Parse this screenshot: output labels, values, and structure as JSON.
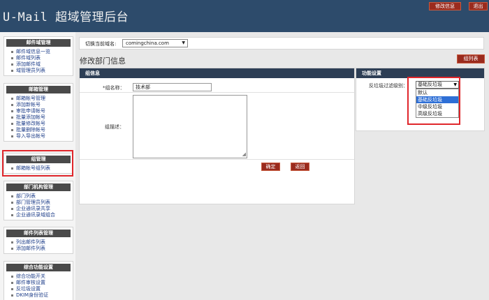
{
  "header": {
    "title": "U-Mail 超域管理后台",
    "change_password": "修改信息",
    "logout": "退出"
  },
  "sidebar": {
    "sections": [
      {
        "title": "邮件域管理",
        "items": [
          "邮件域信息一览",
          "邮件域列表",
          "添加邮件域",
          "域管理员列表"
        ]
      },
      {
        "title": "邮箱管理",
        "items": [
          "邮箱帐号管理",
          "添加新帐号",
          "审批申请帐号",
          "批量添加帐号",
          "批量修改帐号",
          "批量删除帐号",
          "导入导出帐号"
        ]
      },
      {
        "title": "组管理",
        "items": [
          "邮箱帐号组列表"
        ]
      },
      {
        "title": "部门机构管理",
        "items": [
          "部门列表",
          "部门管理员列表",
          "企业通讯录共享",
          "企业通讯录域组合"
        ]
      },
      {
        "title": "邮件列表管理",
        "items": [
          "列出邮件列表",
          "添加邮件列表"
        ]
      },
      {
        "title": "综合功能设置",
        "items": [
          "综合功能开关",
          "邮件审核设置",
          "反垃圾设置",
          "DKIM身份验证"
        ]
      }
    ]
  },
  "domain_bar": {
    "label": "切换当前域名:",
    "selected": "comingchina.com"
  },
  "page": {
    "title": "修改部门信息",
    "group_list_button": "组列表"
  },
  "group_info": {
    "header": "组信息",
    "name_label": "*组名称：",
    "name_value": "技术部",
    "desc_label": "组描述：",
    "confirm_button": "确定",
    "back_button": "返回"
  },
  "features": {
    "header": "功能设置",
    "spam_label": "反垃圾过滤级别：",
    "spam_selected": "基础反垃圾",
    "spam_options": [
      "默认",
      "基础反垃圾",
      "中级反垃圾",
      "高级反垃圾"
    ],
    "spam_highlighted_index": 1
  }
}
